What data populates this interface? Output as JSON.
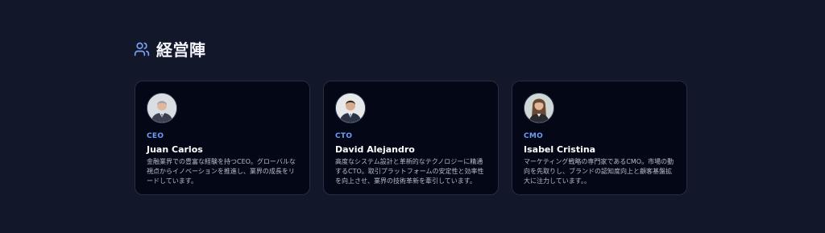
{
  "section": {
    "icon": "users-icon",
    "title": "経営陣"
  },
  "team": [
    {
      "avatar": "avatar-man-gray-hair",
      "role": "CEO",
      "name": "Juan Carlos",
      "description": "金融業界での豊富な経験を持つCEO。グローバルな視点からイノベーションを推進し、業界の成長をリードしています。"
    },
    {
      "avatar": "avatar-man-dark-hair",
      "role": "CTO",
      "name": "David Alejandro",
      "description": "高度なシステム設計と革新的なテクノロジーに精通するCTO。取引プラットフォームの安定性と効率性を向上させ、業界の技術革新を牽引しています。"
    },
    {
      "avatar": "avatar-woman-long-hair",
      "role": "CMO",
      "name": "Isabel Cristina",
      "description": "マーケティング戦略の専門家であるCMO。市場の動向を先取りし、ブランドの認知度向上と顧客基盤拡大に注力しています。。"
    }
  ],
  "colors": {
    "background": "#121729",
    "card_background": "#040716",
    "card_border": "#252c44",
    "accent": "#6e9cf6"
  }
}
